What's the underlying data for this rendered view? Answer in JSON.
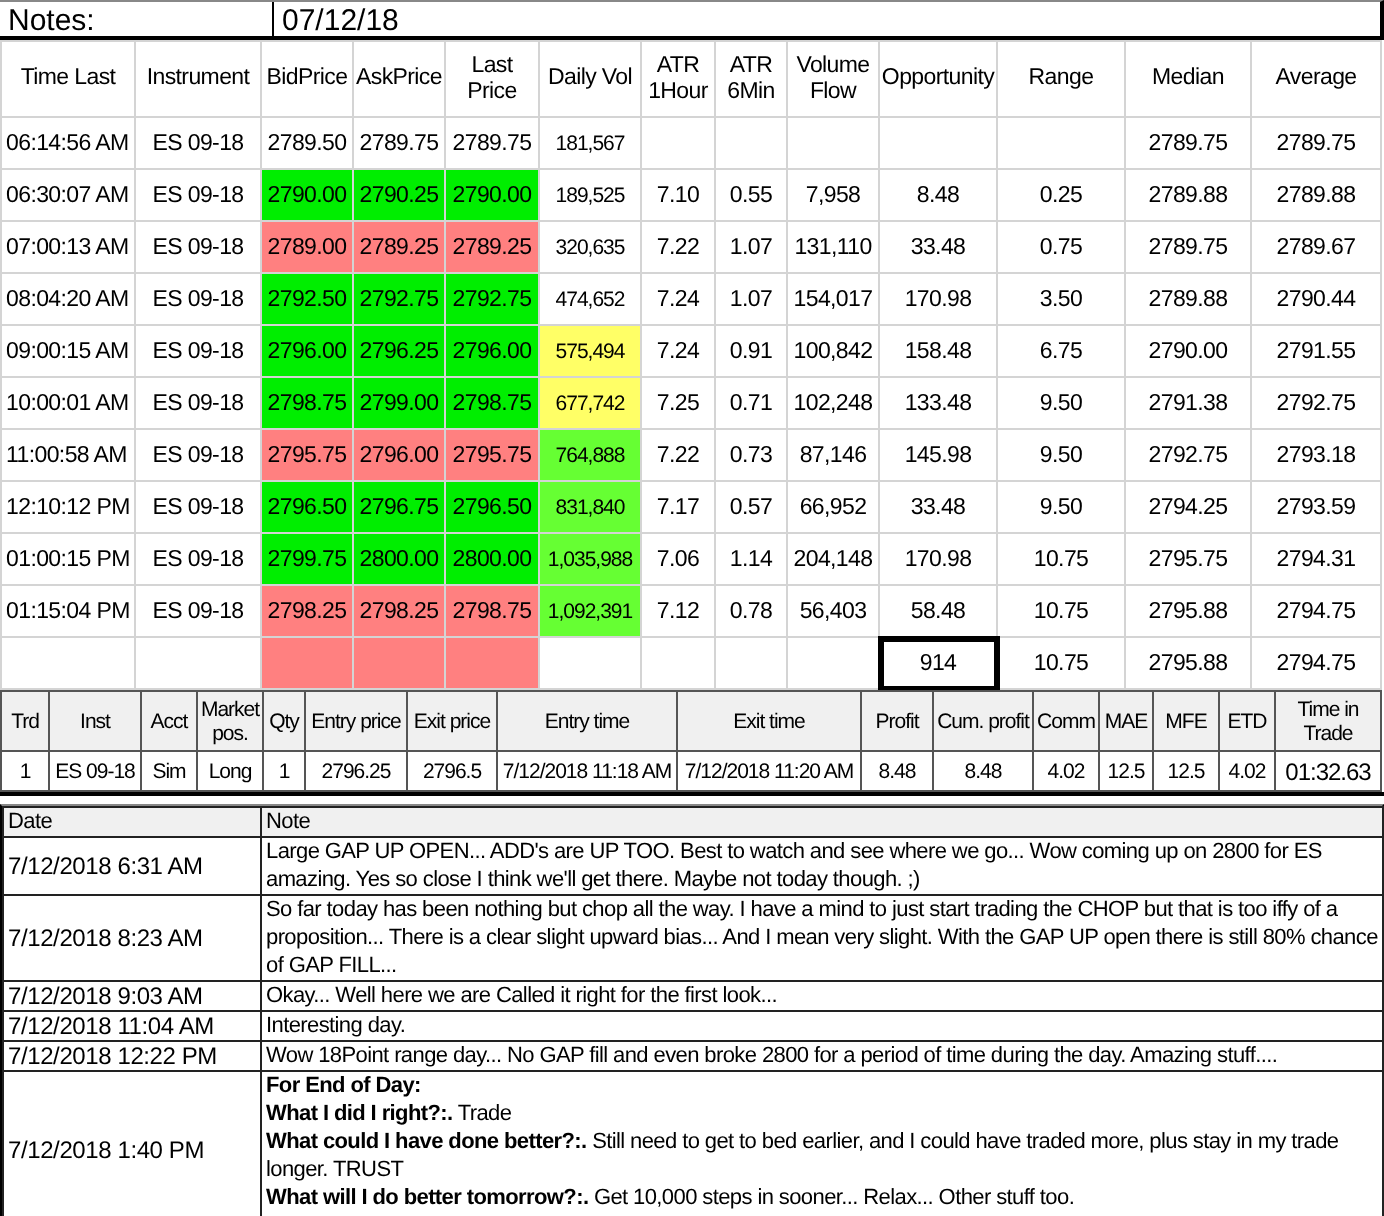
{
  "notes_bar": {
    "label": "Notes:",
    "date": "07/12/18"
  },
  "market_table": {
    "columns": [
      "Time Last",
      "Instrument",
      "BidPrice",
      "AskPrice",
      "Last Price",
      "Daily Vol",
      "ATR 1Hour",
      "ATR 6Min",
      "Volume Flow",
      "Opportunity",
      "Range",
      "Median",
      "Average"
    ],
    "rows": [
      {
        "time": "06:14:56 AM",
        "instrument": "ES 09-18",
        "prices": {
          "bid": "2789.50",
          "ask": "2789.75",
          "last": "2789.75"
        },
        "daily_vol": {
          "text": "181,567",
          "color": "#ffffff"
        },
        "median": "2789.75",
        "average": "2789.75"
      },
      {
        "time": "06:30:07 AM",
        "instrument": "ES 09-18",
        "prices": {
          "bid": "2790.00",
          "ask": "2790.25",
          "last": "2790.00",
          "color": "#00ee00"
        },
        "daily_vol": {
          "text": "189,525",
          "color": "#ffffff"
        },
        "atr_1h": "7.10",
        "atr_6m": "0.55",
        "volume_flow": "7,958",
        "opportunity": "8.48",
        "range": "0.25",
        "median": "2789.88",
        "average": "2789.88"
      },
      {
        "time": "07:00:13 AM",
        "instrument": "ES 09-18",
        "prices": {
          "bid": "2789.00",
          "ask": "2789.25",
          "last": "2789.25",
          "color": "#ff8080"
        },
        "daily_vol": {
          "text": "320,635",
          "color": "#ffffff"
        },
        "atr_1h": "7.22",
        "atr_6m": "1.07",
        "volume_flow": "131,110",
        "opportunity": "33.48",
        "range": "0.75",
        "median": "2789.75",
        "average": "2789.67"
      },
      {
        "time": "08:04:20 AM",
        "instrument": "ES 09-18",
        "prices": {
          "bid": "2792.50",
          "ask": "2792.75",
          "last": "2792.75",
          "color": "#00ee00"
        },
        "daily_vol": {
          "text": "474,652",
          "color": "#ffffff"
        },
        "atr_1h": "7.24",
        "atr_6m": "1.07",
        "volume_flow": "154,017",
        "opportunity": "170.98",
        "range": "3.50",
        "median": "2789.88",
        "average": "2790.44"
      },
      {
        "time": "09:00:15 AM",
        "instrument": "ES 09-18",
        "prices": {
          "bid": "2796.00",
          "ask": "2796.25",
          "last": "2796.00",
          "color": "#00ee00"
        },
        "daily_vol": {
          "text": "575,494",
          "color": "#ffff66"
        },
        "atr_1h": "7.24",
        "atr_6m": "0.91",
        "volume_flow": "100,842",
        "opportunity": "158.48",
        "range": "6.75",
        "median": "2790.00",
        "average": "2791.55"
      },
      {
        "time": "10:00:01 AM",
        "instrument": "ES 09-18",
        "prices": {
          "bid": "2798.75",
          "ask": "2799.00",
          "last": "2798.75",
          "color": "#00ee00"
        },
        "daily_vol": {
          "text": "677,742",
          "color": "#ffff66"
        },
        "atr_1h": "7.25",
        "atr_6m": "0.71",
        "volume_flow": "102,248",
        "opportunity": "133.48",
        "range": "9.50",
        "median": "2791.38",
        "average": "2792.75"
      },
      {
        "time": "11:00:58 AM",
        "instrument": "ES 09-18",
        "prices": {
          "bid": "2795.75",
          "ask": "2796.00",
          "last": "2795.75",
          "color": "#ff8080"
        },
        "daily_vol": {
          "text": "764,888",
          "color": "#66ff33"
        },
        "atr_1h": "7.22",
        "atr_6m": "0.73",
        "volume_flow": "87,146",
        "opportunity": "145.98",
        "range": "9.50",
        "median": "2792.75",
        "average": "2793.18"
      },
      {
        "time": "12:10:12 PM",
        "instrument": "ES 09-18",
        "prices": {
          "bid": "2796.50",
          "ask": "2796.75",
          "last": "2796.50",
          "color": "#00ee00"
        },
        "daily_vol": {
          "text": "831,840",
          "color": "#66ff33"
        },
        "atr_1h": "7.17",
        "atr_6m": "0.57",
        "volume_flow": "66,952",
        "opportunity": "33.48",
        "range": "9.50",
        "median": "2794.25",
        "average": "2793.59"
      },
      {
        "time": "01:00:15 PM",
        "instrument": "ES 09-18",
        "prices": {
          "bid": "2799.75",
          "ask": "2800.00",
          "last": "2800.00",
          "color": "#00ee00"
        },
        "daily_vol": {
          "text": "1,035,988",
          "color": "#66ff33"
        },
        "atr_1h": "7.06",
        "atr_6m": "1.14",
        "volume_flow": "204,148",
        "opportunity": "170.98",
        "range": "10.75",
        "median": "2795.75",
        "average": "2794.31"
      },
      {
        "time": "01:15:04 PM",
        "instrument": "ES 09-18",
        "prices": {
          "bid": "2798.25",
          "ask": "2798.25",
          "last": "2798.75",
          "color": "#ff8080"
        },
        "daily_vol": {
          "text": "1,092,391",
          "color": "#66ff33"
        },
        "atr_1h": "7.12",
        "atr_6m": "0.78",
        "volume_flow": "56,403",
        "opportunity": "58.48",
        "range": "10.75",
        "median": "2795.88",
        "average": "2794.75"
      },
      {
        "prices": {
          "color": "#ff8080"
        },
        "opportunity": "914",
        "selected": true,
        "range": "10.75",
        "median": "2795.88",
        "average": "2794.75"
      }
    ]
  },
  "trade_table": {
    "columns": [
      "Trd",
      "Inst",
      "Acct",
      "Market pos.",
      "Qty",
      "Entry price",
      "Exit price",
      "Entry time",
      "Exit time",
      "Profit",
      "Cum. profit",
      "Comm",
      "MAE",
      "MFE",
      "ETD",
      "Time in Trade"
    ],
    "rows": [
      [
        "1",
        "ES 09-18",
        "Sim",
        "Long",
        "1",
        "2796.25",
        "2796.5",
        "7/12/2018 11:18 AM",
        "7/12/2018 11:20 AM",
        "8.48",
        "8.48",
        "4.02",
        "12.5",
        "12.5",
        "4.02",
        "01:32.63"
      ]
    ]
  },
  "journal": {
    "columns": [
      "Date",
      "Note"
    ],
    "entries": [
      {
        "date": "7/12/2018 6:31 AM",
        "lines": [
          "Large GAP UP OPEN... ADD's are UP TOO.  Best to watch and see where we go... Wow coming up on 2800 for ES amazing.  Yes so close I think we'll get there.  Maybe not today though. ;)"
        ]
      },
      {
        "date": "7/12/2018 8:23 AM",
        "lines": [
          "So far today has been nothing but chop all the way.  I have a mind to just start trading the CHOP but that is too iffy of a proposition... There is a clear slight upward bias... And I mean very slight.  With the GAP UP open there is still 80% chance of GAP FILL..."
        ]
      },
      {
        "date": "7/12/2018 9:03 AM",
        "lines": [
          "Okay... Well here we are Called it right for the first look..."
        ]
      },
      {
        "date": "7/12/2018 11:04 AM",
        "lines": [
          "Interesting day."
        ]
      },
      {
        "date": "7/12/2018 12:22 PM",
        "lines": [
          "Wow 18Point range day... No GAP fill and even broke 2800 for a period of time during the day.  Amazing stuff...."
        ]
      },
      {
        "date": "7/12/2018 1:40 PM",
        "lines": [
          "**For End of Day:**",
          "**What I did I right?:.**  Trade",
          "**What could I have done better?:.**  Still need to get to bed earlier, and I could have traded more, plus stay in my trade longer.  TRUST",
          "**What will I do better tomorrow?:.**  Get 10,000 steps in sooner... Relax... Other stuff too."
        ]
      }
    ]
  }
}
